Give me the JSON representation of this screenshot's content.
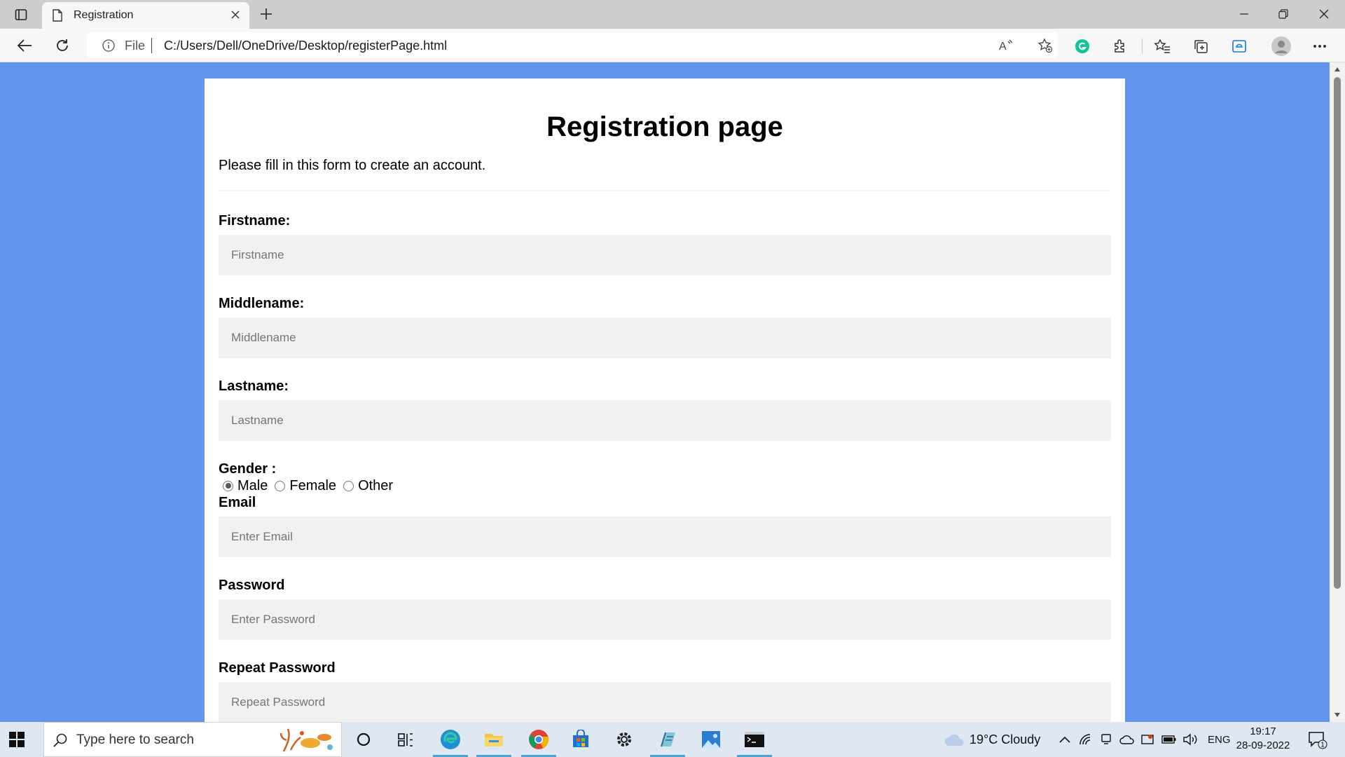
{
  "browser": {
    "tab": {
      "title": "Registration"
    },
    "address": {
      "scheme_label": "File",
      "url": "C:/Users/Dell/OneDrive/Desktop/registerPage.html"
    },
    "icons": [
      "tab-actions-icon",
      "document-icon",
      "close-icon",
      "plus-icon",
      "minimize-icon",
      "restore-icon",
      "close-window-icon",
      "back-icon",
      "refresh-icon",
      "info-icon",
      "read-aloud-icon",
      "add-favorite-icon",
      "grammarly-icon",
      "extensions-icon",
      "favorites-icon",
      "collections-icon",
      "edge-bar-icon",
      "profile-avatar-icon",
      "more-icon"
    ]
  },
  "page": {
    "heading": "Registration page",
    "intro": "Please fill in this form to create an account.",
    "fields": {
      "firstname": {
        "label": "Firstname:",
        "placeholder": "Firstname"
      },
      "middlename": {
        "label": "Middlename:",
        "placeholder": "Middlename"
      },
      "lastname": {
        "label": "Lastname:",
        "placeholder": "Lastname"
      },
      "email": {
        "label": "Email",
        "placeholder": "Enter Email"
      },
      "password": {
        "label": "Password",
        "placeholder": "Enter Password"
      },
      "repeat_password": {
        "label": "Repeat Password",
        "placeholder": "Repeat Password"
      }
    },
    "gender": {
      "label": "Gender :",
      "options": [
        "Male",
        "Female",
        "Other"
      ],
      "selected": "Male"
    }
  },
  "taskbar": {
    "search_placeholder": "Type here to search",
    "weather": "19°C  Cloudy",
    "language": "ENG",
    "time": "19:17",
    "date": "28-09-2022",
    "notification_count": "1",
    "apps": [
      "cortana-icon",
      "task-view-icon",
      "edge-icon",
      "file-explorer-icon",
      "chrome-icon",
      "store-icon",
      "settings-icon",
      "notepad-icon",
      "photos-icon",
      "terminal-icon"
    ]
  },
  "colors": {
    "page_background": "#6495ed",
    "input_background": "#f1f1f1",
    "taskbar": "#dfe7f2"
  }
}
